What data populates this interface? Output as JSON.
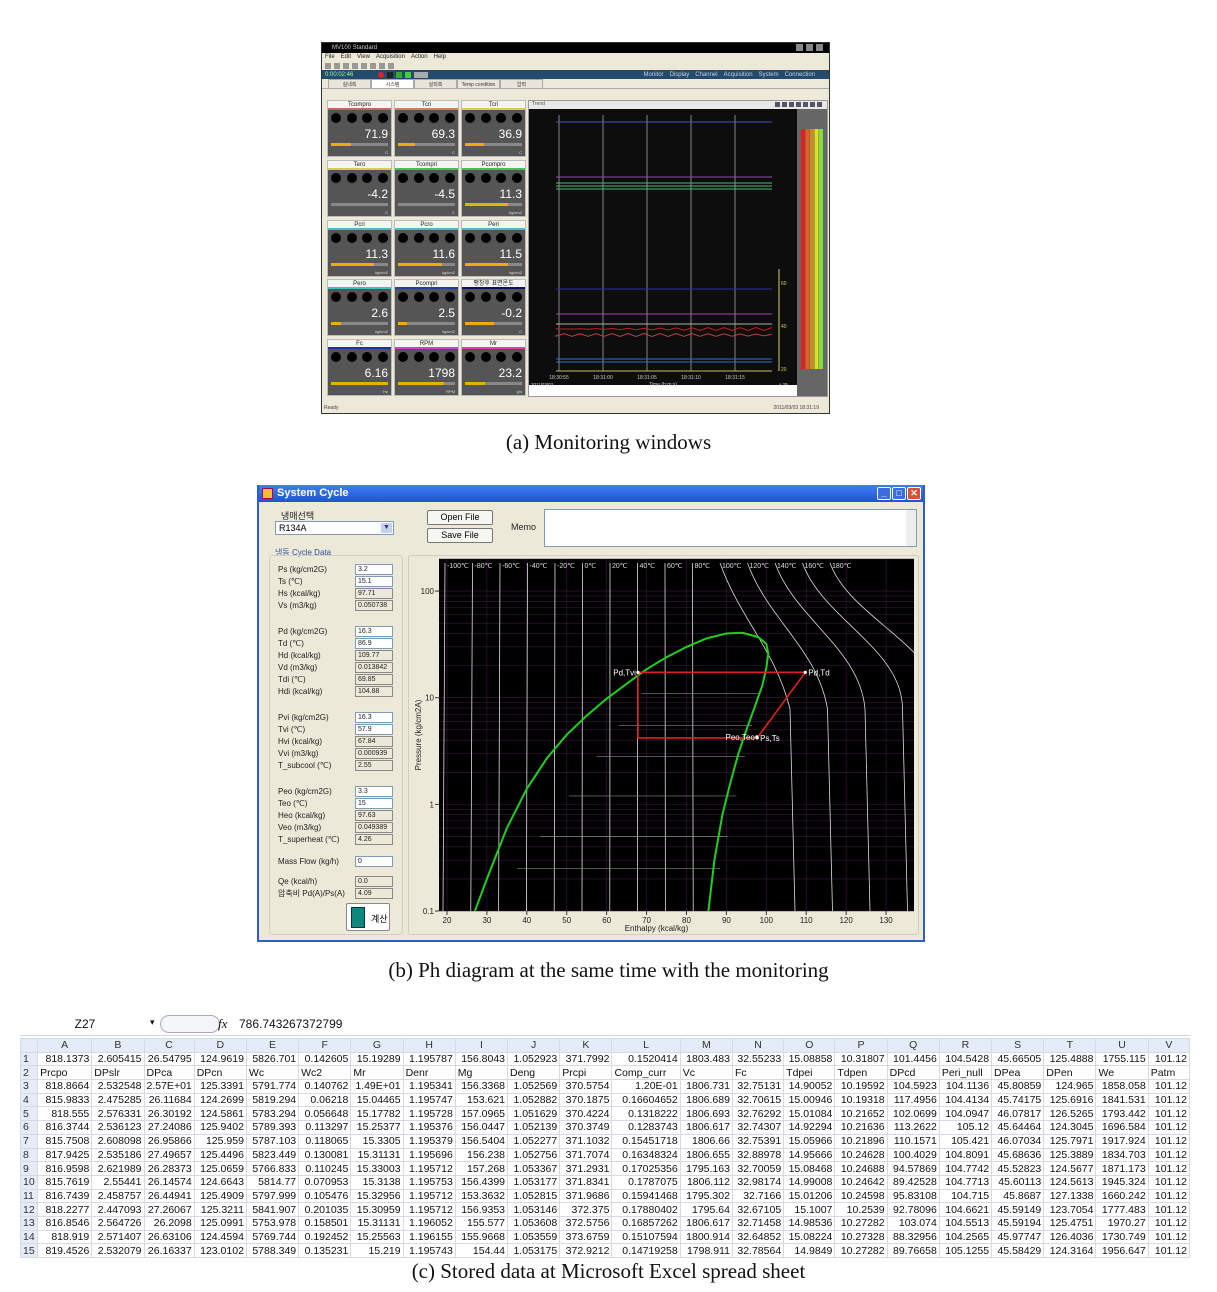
{
  "monitor": {
    "title": "MV100 Standard",
    "menu": [
      "File",
      "Edit",
      "View",
      "Acquisition",
      "Action",
      "Help"
    ],
    "time": "0:00:02:46",
    "nav": [
      "Monitor",
      "Display",
      "Channel",
      "Acquisition",
      "System",
      "Connection"
    ],
    "tabs": [
      "실내측",
      "시스템",
      "실외측",
      "Temp condition",
      "압력"
    ],
    "active_tab": 1,
    "gauges": [
      {
        "name": "Tcompro",
        "value": "71.9",
        "unit": "C",
        "fill": 0.35,
        "color": "#d06060"
      },
      {
        "name": "Tcri",
        "value": "69.3",
        "unit": "C",
        "fill": 0.3,
        "color": "#d08060"
      },
      {
        "name": "Tcri",
        "value": "36.9",
        "unit": "C",
        "fill": 0.33,
        "color": "#d8d040"
      },
      {
        "name": "Tero",
        "value": "-4.2",
        "unit": "C",
        "fill": 0.0,
        "color": "#d8d040"
      },
      {
        "name": "Tcompri",
        "value": "-4.5",
        "unit": "C",
        "fill": 0.0,
        "color": "#40c060"
      },
      {
        "name": "Pcompro",
        "value": "11.3",
        "unit": "kg/cm2",
        "fill": 0.75,
        "color": "#40c060"
      },
      {
        "name": "Pcri",
        "value": "11.3",
        "unit": "kg/cm2",
        "fill": 0.75,
        "color": "#40c0c0"
      },
      {
        "name": "Pcro",
        "value": "11.6",
        "unit": "kg/cm2",
        "fill": 0.78,
        "color": "#40c0c0"
      },
      {
        "name": "Peri",
        "value": "11.5",
        "unit": "kg/cm2",
        "fill": 0.76,
        "color": "#40c0c0"
      },
      {
        "name": "Pero",
        "value": "2.6",
        "unit": "kg/cm2",
        "fill": 0.17,
        "color": "#40c0c0"
      },
      {
        "name": "Pcompri",
        "value": "2.5",
        "unit": "kg/cm2",
        "fill": 0.16,
        "color": "#2040a0"
      },
      {
        "name": "팽창후 표면온도",
        "value": "-0.2",
        "unit": "C",
        "fill": 0.5,
        "color": "#101060"
      },
      {
        "name": "Fc",
        "value": "6.16",
        "unit": "Hz",
        "fill": 1.0,
        "color": "#2030a0"
      },
      {
        "name": "RPM",
        "value": "1798",
        "unit": "RPM",
        "fill": 0.8,
        "color": "#d040d0"
      },
      {
        "name": "Mr",
        "value": "23.2",
        "unit": "g/s",
        "fill": 0.35,
        "color": "#e040a0"
      }
    ],
    "trend": {
      "header": "Trend",
      "time_ticks": [
        "18:30:55",
        "18:31:00",
        "18:31:05",
        "18:31:10",
        "18:31:15"
      ],
      "xlabel": "Time (h:m:s)",
      "date_label": "2011/03/03",
      "zoom_label": "x 29",
      "yticks": [
        "60",
        "40",
        "20"
      ],
      "ylabel": "Ten (°C)"
    },
    "status_left": "Ready",
    "status_right": "2011/03/03 18:31:19"
  },
  "caption_a": "(a)  Monitoring windows",
  "system": {
    "title": "System Cycle",
    "refrigerant_label": "냉매선택",
    "refrigerant": "R134A",
    "open_file": "Open File",
    "save_file": "Save File",
    "memo_label": "Memo",
    "memo": "",
    "cycle_data_title": "냉동 Cycle Data",
    "params": [
      {
        "label": "Ps (kg/cm2G)",
        "value": "3.2",
        "input": true
      },
      {
        "label": "Ts (℃)",
        "value": "15.1",
        "input": true
      },
      {
        "label": "Hs (kcal/kg)",
        "value": "97.71",
        "input": false
      },
      {
        "label": "Vs (m3/kg)",
        "value": "0.050738",
        "input": false
      },
      {
        "label": "Pd (kg/cm2G)",
        "value": "16.3",
        "input": true
      },
      {
        "label": "Td (℃)",
        "value": "86.9",
        "input": true
      },
      {
        "label": "Hd (kcal/kg)",
        "value": "109.77",
        "input": false
      },
      {
        "label": "Vd (m3/kg)",
        "value": "0.013842",
        "input": false
      },
      {
        "label": "Tdi (℃)",
        "value": "69.85",
        "input": false
      },
      {
        "label": "Hdi (kcal/kg)",
        "value": "104.88",
        "input": false
      },
      {
        "label": "Pvi (kg/cm2G)",
        "value": "16.3",
        "input": true
      },
      {
        "label": "Tvi (℃)",
        "value": "57.9",
        "input": true
      },
      {
        "label": "Hvi (kcal/kg)",
        "value": "67.84",
        "input": false
      },
      {
        "label": "Vvi (m3/kg)",
        "value": "0.000939",
        "input": false
      },
      {
        "label": "T_subcool (℃)",
        "value": "2.55",
        "input": false
      },
      {
        "label": "Peo (kg/cm2G)",
        "value": "3.3",
        "input": true
      },
      {
        "label": "Teo (℃)",
        "value": "15",
        "input": true
      },
      {
        "label": "Heo (kcal/kg)",
        "value": "97.63",
        "input": false
      },
      {
        "label": "Veo (m3/kg)",
        "value": "0.049389",
        "input": false
      },
      {
        "label": "T_superheat (℃)",
        "value": "4.26",
        "input": false
      },
      {
        "label": "Mass Flow (kg/h)",
        "value": "0",
        "input": true
      },
      {
        "label": "Qe (kcal/h)",
        "value": "0.0",
        "input": false
      },
      {
        "label": "압축비 Pd(A)/Ps(A)",
        "value": "4.09",
        "input": false
      }
    ],
    "calc_button": "계산"
  },
  "chart_data": {
    "type": "line",
    "title": "",
    "xlabel": "Enthalpy (kcal/kg)",
    "ylabel": "Pressure (kg/cm2A)",
    "xlim": [
      18,
      137
    ],
    "ylim": [
      0.1,
      200
    ],
    "yscale": "log",
    "xticks": [
      20,
      30,
      40,
      50,
      60,
      70,
      80,
      90,
      100,
      110,
      120,
      130
    ],
    "yticks": [
      {
        "v": 0.1,
        "label": "0.1"
      },
      {
        "v": 1,
        "label": "1"
      },
      {
        "v": 10,
        "label": "10"
      },
      {
        "v": 100,
        "label": "100"
      }
    ],
    "isotherm_labels": [
      "-100℃",
      "-80℃",
      "-60℃",
      "-40℃",
      "-20℃",
      "0℃",
      "20℃",
      "40℃",
      "60℃",
      "80℃",
      "100℃",
      "120℃",
      "140℃",
      "160℃",
      "180℃"
    ],
    "saturation_dome": {
      "liquid": [
        [
          27,
          0.1
        ],
        [
          30,
          0.2
        ],
        [
          35,
          0.6
        ],
        [
          40,
          1.4
        ],
        [
          45,
          2.7
        ],
        [
          50,
          4.5
        ],
        [
          55,
          6.8
        ],
        [
          60,
          9.8
        ],
        [
          65,
          13.5
        ],
        [
          70,
          18.5
        ],
        [
          75,
          24
        ],
        [
          80,
          30
        ],
        [
          85,
          36
        ],
        [
          90,
          40
        ],
        [
          94,
          40.6
        ]
      ],
      "vapor": [
        [
          85.5,
          0.1
        ],
        [
          87,
          0.3
        ],
        [
          89,
          0.8
        ],
        [
          91,
          1.6
        ],
        [
          93,
          3
        ],
        [
          95,
          5
        ],
        [
          97,
          8
        ],
        [
          99,
          13
        ],
        [
          100,
          19
        ],
        [
          100.5,
          26
        ],
        [
          100,
          32
        ],
        [
          98,
          37
        ],
        [
          94,
          40.6
        ]
      ]
    },
    "cycle": {
      "points": [
        {
          "label": "Pd,Tvi",
          "h": 67.84,
          "p": 17.3
        },
        {
          "label": "Pd,Td",
          "h": 109.77,
          "p": 17.3
        },
        {
          "label": "Ps,Ts",
          "h": 97.71,
          "p": 4.2
        },
        {
          "label": "Peo,Teo",
          "h": 97.63,
          "p": 4.3
        }
      ],
      "path": [
        [
          67.84,
          17.3
        ],
        [
          109.77,
          17.3
        ],
        [
          97.71,
          4.2
        ],
        [
          67.84,
          4.2
        ],
        [
          67.84,
          17.3
        ]
      ],
      "color": "#e02020"
    },
    "dome_color": "#20d020"
  },
  "caption_b": "(b)  Ph diagram at the same time with the monitoring",
  "excel": {
    "name_box": "Z27",
    "fx_label": "fx",
    "formula": "786.743267372799",
    "columns": [
      "A",
      "B",
      "C",
      "D",
      "E",
      "F",
      "G",
      "H",
      "I",
      "J",
      "K",
      "L",
      "M",
      "N",
      "O",
      "P",
      "Q",
      "R",
      "S",
      "T",
      "U",
      "V"
    ],
    "rows": [
      [
        "818.1373",
        "2.605415",
        "26.54795",
        "124.9619",
        "5826.701",
        "0.142605",
        "15.19289",
        "1.195787",
        "156.8043",
        "1.052923",
        "371.7992",
        "0.1520414",
        "1803.483",
        "32.55233",
        "15.08858",
        "10.31807",
        "101.4456",
        "104.5428",
        "45.66505",
        "125.4888",
        "1755.115",
        "101.12"
      ],
      [
        "Prcpo",
        "DPslr",
        "DPca",
        "DPcn",
        "Wc",
        "Wc2",
        "Mr",
        "Denr",
        "Mg",
        "Deng",
        "Prcpi",
        "Comp_curr",
        "Vc",
        "Fc",
        "Tdpei",
        "Tdpen",
        "DPcd",
        "Peri_null",
        "DPea",
        "DPen",
        "We",
        "Patm"
      ],
      [
        "818.8664",
        "2.532548",
        "2.57E+01",
        "125.3391",
        "5791.774",
        "0.140762",
        "1.49E+01",
        "1.195341",
        "156.3368",
        "1.052569",
        "370.5754",
        "1.20E-01",
        "1806.731",
        "32.75131",
        "14.90052",
        "10.19592",
        "104.5923",
        "104.1136",
        "45.80859",
        "124.965",
        "1858.058",
        "101.12"
      ],
      [
        "815.9833",
        "2.475285",
        "26.11684",
        "124.2699",
        "5819.294",
        "0.06218",
        "15.04465",
        "1.195747",
        "153.621",
        "1.052882",
        "370.1875",
        "0.16604652",
        "1806.689",
        "32.70615",
        "15.00946",
        "10.19318",
        "117.4956",
        "104.4134",
        "45.74175",
        "125.6916",
        "1841.531",
        "101.12"
      ],
      [
        "818.555",
        "2.576331",
        "26.30192",
        "124.5861",
        "5783.294",
        "0.056648",
        "15.17782",
        "1.195728",
        "157.0965",
        "1.051629",
        "370.4224",
        "0.1318222",
        "1806.693",
        "32.76292",
        "15.01084",
        "10.21652",
        "102.0699",
        "104.0947",
        "46.07817",
        "126.5265",
        "1793.442",
        "101.12"
      ],
      [
        "816.3744",
        "2.536123",
        "27.24086",
        "125.9402",
        "5789.393",
        "0.113297",
        "15.25377",
        "1.195376",
        "156.0447",
        "1.052139",
        "370.3749",
        "0.1283743",
        "1806.617",
        "32.74307",
        "14.92294",
        "10.21636",
        "113.2622",
        "105.12",
        "45.64464",
        "124.3045",
        "1696.584",
        "101.12"
      ],
      [
        "815.7508",
        "2.608098",
        "26.95866",
        "125.959",
        "5787.103",
        "0.118065",
        "15.3305",
        "1.195379",
        "156.5404",
        "1.052277",
        "371.1032",
        "0.15451718",
        "1806.66",
        "32.75391",
        "15.05966",
        "10.21896",
        "110.1571",
        "105.421",
        "46.07034",
        "125.7971",
        "1917.924",
        "101.12"
      ],
      [
        "817.9425",
        "2.535186",
        "27.49657",
        "125.4496",
        "5823.449",
        "0.130081",
        "15.31131",
        "1.195696",
        "156.238",
        "1.052756",
        "371.7074",
        "0.16348324",
        "1806.655",
        "32.88978",
        "14.95666",
        "10.24628",
        "100.4029",
        "104.8091",
        "45.68636",
        "125.3889",
        "1834.703",
        "101.12"
      ],
      [
        "816.9598",
        "2.621989",
        "26.28373",
        "125.0659",
        "5766.833",
        "0.110245",
        "15.33003",
        "1.195712",
        "157.268",
        "1.053367",
        "371.2931",
        "0.17025356",
        "1795.163",
        "32.70059",
        "15.08468",
        "10.24688",
        "94.57869",
        "104.7742",
        "45.52823",
        "124.5677",
        "1871.173",
        "101.12"
      ],
      [
        "815.7619",
        "2.55441",
        "26.14574",
        "124.6643",
        "5814.77",
        "0.070953",
        "15.3138",
        "1.195753",
        "156.4399",
        "1.053177",
        "371.8341",
        "0.1787075",
        "1806.112",
        "32.98174",
        "14.99008",
        "10.24642",
        "89.42528",
        "104.7713",
        "45.60113",
        "124.5613",
        "1945.324",
        "101.12"
      ],
      [
        "816.7439",
        "2.458757",
        "26.44941",
        "125.4909",
        "5797.999",
        "0.105476",
        "15.32956",
        "1.195712",
        "153.3632",
        "1.052815",
        "371.9686",
        "0.15941468",
        "1795.302",
        "32.7166",
        "15.01206",
        "10.24598",
        "95.83108",
        "104.715",
        "45.8687",
        "127.1338",
        "1660.242",
        "101.12"
      ],
      [
        "818.2277",
        "2.447093",
        "27.26067",
        "125.3211",
        "5841.907",
        "0.201035",
        "15.30959",
        "1.195712",
        "156.9353",
        "1.053146",
        "372.375",
        "0.17880402",
        "1795.64",
        "32.67105",
        "15.1007",
        "10.2539",
        "92.78096",
        "104.6621",
        "45.59149",
        "123.7054",
        "1777.483",
        "101.12"
      ],
      [
        "816.8546",
        "2.564726",
        "26.2098",
        "125.0991",
        "5753.978",
        "0.158501",
        "15.31131",
        "1.196052",
        "155.577",
        "1.053608",
        "372.5756",
        "0.16857262",
        "1806.617",
        "32.71458",
        "14.98536",
        "10.27282",
        "103.074",
        "104.5513",
        "45.59194",
        "125.4751",
        "1970.27",
        "101.12"
      ],
      [
        "818.919",
        "2.571407",
        "26.63106",
        "124.4594",
        "5769.744",
        "0.192452",
        "15.25563",
        "1.196155",
        "155.9668",
        "1.053559",
        "373.6759",
        "0.15107594",
        "1800.914",
        "32.64852",
        "15.08224",
        "10.27328",
        "88.32956",
        "104.2565",
        "45.97747",
        "126.4036",
        "1730.749",
        "101.12"
      ],
      [
        "819.4526",
        "2.532079",
        "26.16337",
        "123.0102",
        "5788.349",
        "0.135231",
        "15.219",
        "1.195743",
        "154.44",
        "1.053175",
        "372.9212",
        "0.14719258",
        "1798.911",
        "32.78564",
        "14.9849",
        "10.27282",
        "89.76658",
        "105.1255",
        "45.58429",
        "124.3164",
        "1956.647",
        "101.12"
      ]
    ]
  },
  "caption_c": "(c)  Stored data at Microsoft Excel spread sheet"
}
